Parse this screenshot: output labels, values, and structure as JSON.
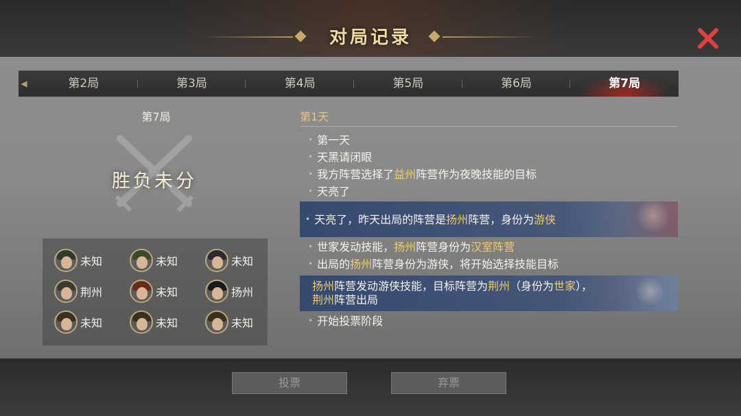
{
  "dialog": {
    "title": "对局记录"
  },
  "tabs": [
    {
      "label": "第2局",
      "active": false
    },
    {
      "label": "第3局",
      "active": false
    },
    {
      "label": "第4局",
      "active": false
    },
    {
      "label": "第5局",
      "active": false
    },
    {
      "label": "第6局",
      "active": false
    },
    {
      "label": "第7局",
      "active": true
    }
  ],
  "left_panel": {
    "round_title": "第7局",
    "result": "胜负未分",
    "players": [
      {
        "name": "未知",
        "hair": "#2e3a2a"
      },
      {
        "name": "未知",
        "hair": "#3a4a2a"
      },
      {
        "name": "未知",
        "hair": "#2a2a30"
      },
      {
        "name": "荆州",
        "hair": "#3a3a30"
      },
      {
        "name": "未知",
        "hair": "#6a2a1a"
      },
      {
        "name": "扬州",
        "hair": "#1a1a1a"
      },
      {
        "name": "未知",
        "hair": "#3a3020"
      },
      {
        "name": "未知",
        "hair": "#3a3020"
      },
      {
        "name": "未知",
        "hair": "#3a3020"
      }
    ]
  },
  "log": {
    "day_title": "第1天",
    "entries": {
      "e1": "第一天",
      "e2": "天黑请闭眼",
      "e3_a": "我方阵营选择了",
      "e3_b": "益州",
      "e3_c": "阵营作为夜晚技能的目标",
      "e4": "天亮了",
      "e5_a": "天亮了，昨天出局的阵营是",
      "e5_b": "扬州",
      "e5_c": "阵营，身份为",
      "e5_d": "游侠",
      "e6_a": "世家发动技能，",
      "e6_b": "扬州",
      "e6_c": "阵营身份为",
      "e6_d": "汉室阵营",
      "e7_a": "出局的",
      "e7_b": "扬州",
      "e7_c": "阵营身份为游侠，将开始选择技能目标",
      "e8_a": "扬州",
      "e8_b": "阵营发动游侠技能，目标阵营为",
      "e8_c": "荆州",
      "e8_d": "（身份为",
      "e8_e": "世家",
      "e8_f": "），",
      "e8_g": "荆州",
      "e8_h": "阵营出局",
      "e9": "开始投票阶段"
    }
  },
  "background": {
    "btn_left": "投票",
    "btn_right": "弃票"
  },
  "colors": {
    "highlight": "#f0cc6a",
    "title_gold": "#f1dca0",
    "close_red": "#e04040"
  }
}
